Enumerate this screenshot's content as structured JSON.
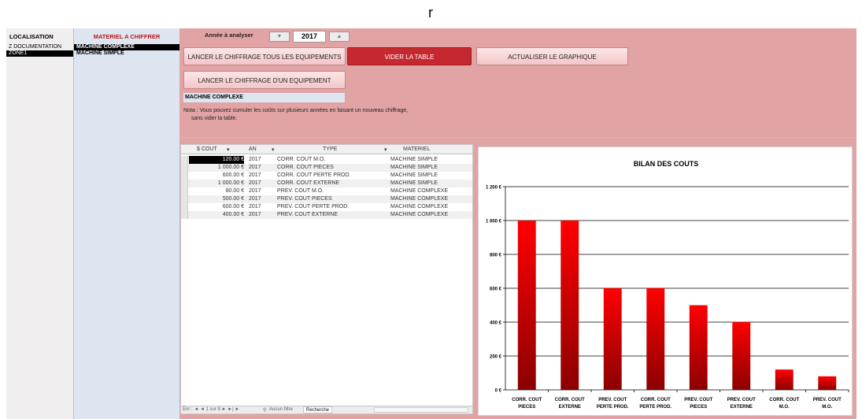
{
  "top_letter": "r",
  "localisation": {
    "header": "LOCALISATION",
    "items": [
      "Z DOCUMENTATION",
      "ZONE1"
    ]
  },
  "materiel": {
    "header": "MATERIEL A CHIFFRER",
    "items": [
      "MACHINE COMPLEXE",
      "MACHINE SIMPLE"
    ]
  },
  "year_label": "Année à analyser",
  "year_value": "2017",
  "buttons": {
    "all": "LANCER LE CHIFFRAGE TOUS LES EQUIPEMENTS",
    "clear": "VIDER LA TABLE",
    "refresh": "ACTUALISER LE GRAPHIQUE",
    "one": "LANCER LE CHIFFRAGE D'UN EQUIPEMENT"
  },
  "selected_materiel": "MACHINE COMPLEXE",
  "note": {
    "line1": "Nota : Vous pouvez cumuler les coûts sur plusieurs années en faisant un nouveau chiffrage,",
    "line2": "sans vider la table."
  },
  "table": {
    "columns": [
      "$ COUT",
      "AN",
      "TYPE",
      "MATERIEL"
    ],
    "rows": [
      {
        "cout": "120.00 €",
        "an": "2017",
        "type": "CORR. COUT M.O.",
        "materiel": "MACHINE SIMPLE"
      },
      {
        "cout": "1 000.00 €",
        "an": "2017",
        "type": "CORR. COUT PIECES",
        "materiel": "MACHINE SIMPLE"
      },
      {
        "cout": "600.00 €",
        "an": "2017",
        "type": "CORR. COUT PERTE PROD.",
        "materiel": "MACHINE SIMPLE"
      },
      {
        "cout": "1 000.00 €",
        "an": "2017",
        "type": "CORR. COUT EXTERNE",
        "materiel": "MACHINE SIMPLE"
      },
      {
        "cout": "80.00 €",
        "an": "2017",
        "type": "PREV. COUT M.O.",
        "materiel": "MACHINE COMPLEXE"
      },
      {
        "cout": "500.00 €",
        "an": "2017",
        "type": "PREV. COUT PIECES",
        "materiel": "MACHINE COMPLEXE"
      },
      {
        "cout": "600.00 €",
        "an": "2017",
        "type": "PREV. COUT PERTE PROD.",
        "materiel": "MACHINE COMPLEXE"
      },
      {
        "cout": "400.00 €",
        "an": "2017",
        "type": "PREV. COUT EXTERNE",
        "materiel": "MACHINE COMPLEXE"
      }
    ],
    "footer": {
      "record_label": "Enr : ◄ ◄ 1 sur 8 ► ►| ►",
      "filter": "Aucun filtre",
      "search": "Recherche",
      "scroll_text": "III"
    }
  },
  "chart_data": {
    "type": "bar",
    "title": "BILAN DES COUTS",
    "categories": [
      [
        "CORR. COUT",
        "PIECES"
      ],
      [
        "CORR. COUT",
        "EXTERNE"
      ],
      [
        "PREV. COUT",
        "PERTE PROD."
      ],
      [
        "CORR. COUT",
        "PERTE PROD."
      ],
      [
        "PREV. COUT",
        "PIECES"
      ],
      [
        "PREV. COUT",
        "EXTERNE"
      ],
      [
        "CORR. COUT",
        "M.O."
      ],
      [
        "PREV. COUT",
        "M.O."
      ]
    ],
    "values": [
      1000,
      1000,
      600,
      600,
      500,
      400,
      120,
      80
    ],
    "ylim": [
      0,
      1200
    ],
    "yticks": [
      "0 €",
      "200 €",
      "400 €",
      "600 €",
      "800 €",
      "1 000 €",
      "1 200 €"
    ],
    "grid": true,
    "bar_color_top": "#ff0000",
    "bar_color_bottom": "#8b0000"
  }
}
